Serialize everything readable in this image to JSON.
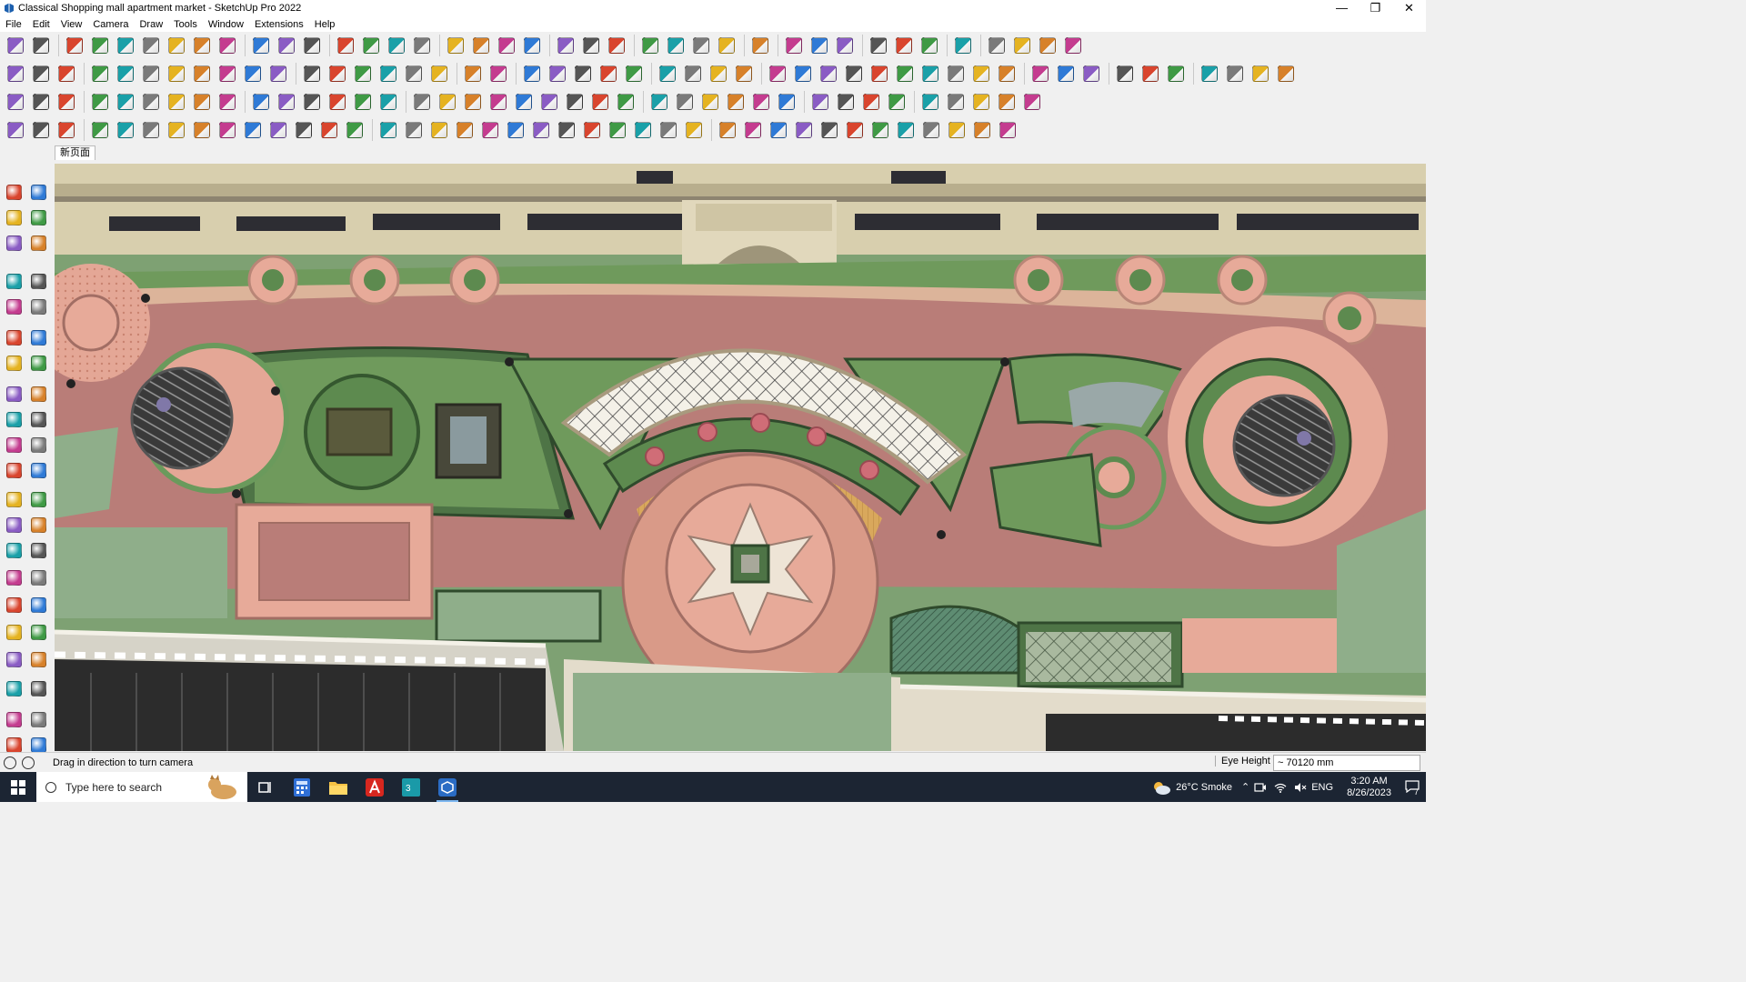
{
  "window": {
    "title": "Classical Shopping mall apartment market - SketchUp Pro 2022",
    "controls": {
      "minimize": "—",
      "maximize": "❐",
      "close": "✕"
    }
  },
  "menu": [
    "File",
    "Edit",
    "View",
    "Camera",
    "Draw",
    "Tools",
    "Window",
    "Extensions",
    "Help"
  ],
  "scene_tab": "新页面",
  "status": {
    "hint": "Drag in direction to turn camera",
    "eye_height_label": "Eye Height",
    "eye_height_value": "~ 70120 mm"
  },
  "taskbar": {
    "search_placeholder": "Type here to search",
    "weather": "26°C  Smoke",
    "language": "ENG",
    "time": "3:20 AM",
    "date": "8/26/2023",
    "notification_count": "7"
  },
  "colors": {
    "paving": "#b97d78",
    "lawn": "#6f9a5c",
    "dark_lawn": "#4e7446",
    "pink_paving": "#e7aa99",
    "building": "#ddd3b5",
    "taskbar": "#1c2533"
  }
}
